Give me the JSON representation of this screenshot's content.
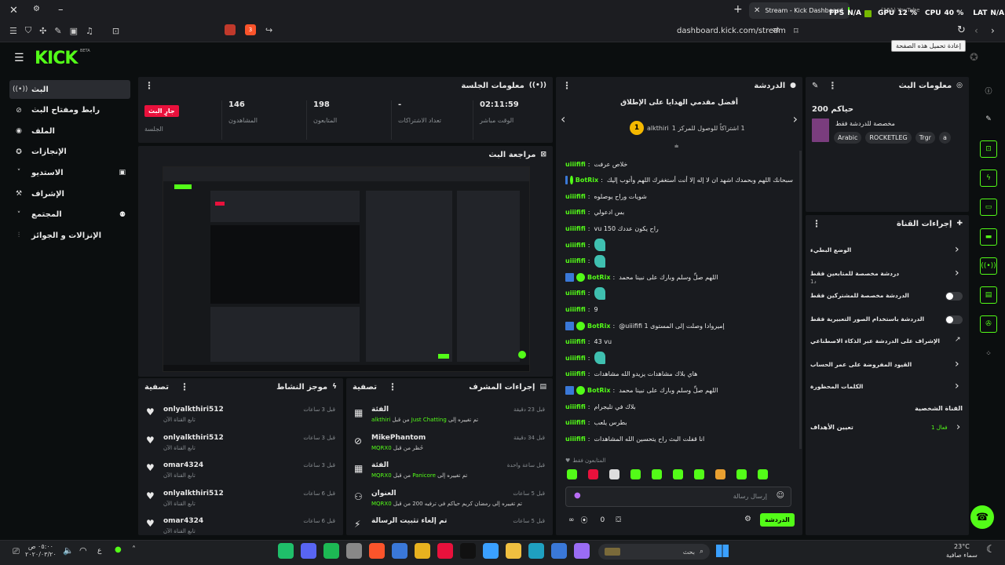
{
  "browser": {
    "tab_title": "Stream - Kick Dashboard",
    "url": "dashboard.kick.com/stream",
    "tooltip": "إعادة تحميل هذه الصفحة",
    "overlay": {
      "fps_label": "FPS",
      "fps": "N/A",
      "gpu_label": "GPU",
      "gpu": "12 %",
      "cpu_label": "CPU",
      "cpu": "40 %",
      "lat_label": "LAT",
      "lat": "N/A",
      "yt": "(161) YouTube"
    },
    "ext_badge": "3"
  },
  "app": {
    "logo": "KICK",
    "beta": "BETA"
  },
  "sidebar": {
    "items": [
      {
        "label": "البث",
        "icon": "broadcast-icon",
        "active": true
      },
      {
        "label": "رابط ومفتاح البث",
        "icon": "link-icon"
      },
      {
        "label": "الملف",
        "icon": "user-icon"
      },
      {
        "label": "الإنجازات",
        "icon": "trophy-icon"
      },
      {
        "label": "الاستديو",
        "icon": "studio-icon"
      },
      {
        "label": "الإشراف",
        "icon": "hammer-icon"
      },
      {
        "label": "المجتمع",
        "icon": "community-icon"
      },
      {
        "label": "الإنزالات و الجوائز",
        "icon": "rewards-icon"
      }
    ]
  },
  "session": {
    "title": "معلومات الجلسة",
    "live_badge": "جارٍ البث",
    "live_sub": "الجلسة",
    "stats": [
      {
        "value": "146",
        "label": "المشاهدون"
      },
      {
        "value": "198",
        "label": "المتابعون"
      },
      {
        "value": "-",
        "label": "تعداد الاشتراكات"
      },
      {
        "value": "02:11:59",
        "label": "الوقت مباشر"
      }
    ]
  },
  "preview": {
    "title": "مراجعة البث"
  },
  "activity": {
    "title": "موجز النشاط",
    "filter": "تصفية",
    "items": [
      {
        "name": "onlyalkthiri512",
        "sub": "تابع القناة الآن",
        "time": "قبل 3 ساعات"
      },
      {
        "name": "onlyalkthiri512",
        "sub": "تابع القناة الآن",
        "time": "قبل 3 ساعات"
      },
      {
        "name": "omar4324",
        "sub": "تابع القناة الآن",
        "time": "قبل 3 ساعات"
      },
      {
        "name": "onlyalkthiri512",
        "sub": "تابع القناة الآن",
        "time": "قبل 6 ساعات"
      },
      {
        "name": "omar4324",
        "sub": "تابع القناة الآن",
        "time": "قبل 6 ساعات"
      }
    ]
  },
  "mod": {
    "title": "إجراءات المشرف",
    "filter": "تصفية",
    "items": [
      {
        "title": "الفئة",
        "detail_pre": "تم تغييره إلى ",
        "detail_green": "Just Chatting",
        "detail_post": " من قبل ",
        "user": "alkthiri",
        "time": "قبل 23 دقيقة",
        "icon": "category-icon"
      },
      {
        "title": "MikePhantom",
        "detail_pre": "حُظر من قبل ",
        "detail_green": "",
        "detail_post": "",
        "user": "MQRX0",
        "time": "قبل 34 دقيقة",
        "icon": "ban-icon"
      },
      {
        "title": "الفئة",
        "detail_pre": "تم تغييره إلى ",
        "detail_green": "Panicore",
        "detail_post": " من قبل ",
        "user": "MQRX0",
        "time": "قبل ساعة واحدة",
        "icon": "category-icon"
      },
      {
        "title": "العنوان",
        "detail_pre": "تم تغييره إلى ",
        "detail_green": "",
        "detail_post": "رمضان كريم حياكم في ترفيه 200 من قبل ",
        "user": "MQRX0",
        "time": "قبل 5 ساعات",
        "icon": "title-icon"
      },
      {
        "title": "تم إلغاء تثبيت الرسالة",
        "detail_pre": "",
        "detail_green": "",
        "detail_post": "",
        "user": "",
        "time": "قبل 5 ساعات",
        "icon": "unpin-icon"
      }
    ]
  },
  "chat": {
    "title": "الدردشة",
    "promo_title": "أفضل مقدمي الهدايا على الإطلاق",
    "promo_sub": "1 اشتراكاً للوصول للمركز 1",
    "promo_rank": "1",
    "promo_user": "alkthiri",
    "messages": [
      {
        "user": "uiiififi",
        "text": "خلاص عرفت"
      },
      {
        "user": "BotRix",
        "bot": true,
        "text": "سبحانك اللهم وبحمدك اشهد ان لا إله إلا أنت أستغفرك اللهم وأتوب إليك"
      },
      {
        "user": "uiiififi",
        "text": "شويات وراح يوصلوه"
      },
      {
        "user": "uiiififi",
        "text": "بس ادعولي"
      },
      {
        "user": "uiiififi",
        "text": "vu راح يكون عددك 150"
      },
      {
        "user": "uiiififi",
        "text": "",
        "emote": true
      },
      {
        "user": "uiiififi",
        "text": "",
        "emote": true
      },
      {
        "user": "BotRix",
        "bot": true,
        "text": "اللهم صلِّ وسلم وبارك على نبينا محمد"
      },
      {
        "user": "uiiififi",
        "text": "",
        "emote": true
      },
      {
        "user": "uiiififi",
        "text": "9"
      },
      {
        "user": "BotRix",
        "bot": true,
        "text": "@uiiififi إميروادا وصلت إلى المستوى 1"
      },
      {
        "user": "uiiififi",
        "text": "43 vu"
      },
      {
        "user": "uiiififi",
        "text": "",
        "emote": true
      },
      {
        "user": "uiiififi",
        "text": "هاي بلاك مشاهدات يزيدو الله مشاهدات"
      },
      {
        "user": "BotRix",
        "bot": true,
        "text": "اللهم صلِّ وسلم وبارك على نبينا محمد"
      },
      {
        "user": "uiiififi",
        "text": "بلاك في تليجرام"
      },
      {
        "user": "uiiififi",
        "text": "بطرس يلعب"
      },
      {
        "user": "uiiififi",
        "text": "انا قفلت البث راح يتحسين الله المشاهدات"
      }
    ],
    "followers_only": "المتابعون فقط",
    "input_placeholder": "إرسال رسالة",
    "send": "الدردشة",
    "viewers_count": "0"
  },
  "stream_info": {
    "title": "معلومات البث",
    "stream_title": "حياكم 200",
    "category": "مخصصة للدردشة فقط",
    "tags": [
      "Arabic",
      "ROCKETLEG",
      "Trgr",
      "a"
    ]
  },
  "channel_actions": {
    "title": "إجراءات القناة",
    "items": [
      {
        "label": "الوضع البطيء",
        "type": "chevron"
      },
      {
        "label": "دردشة مخصصة للمتابعين فقط",
        "sub": "1د",
        "type": "chevron"
      },
      {
        "label": "الدردشة مخصصة للمشتركين فقط",
        "type": "toggle"
      },
      {
        "label": "الدردشة باستخدام الصور التعبيرية فقط",
        "type": "toggle"
      },
      {
        "label": "الإشراف على الدردشة عبر الذكاء الاصطناعي",
        "type": "external"
      },
      {
        "label": "القيود المفروضة على عمر الحساب",
        "type": "chevron"
      },
      {
        "label": "الكلمات المحظورة",
        "type": "chevron"
      }
    ],
    "personal_heading": "القناة الشخصية",
    "goals_label": "تعيين الأهداف",
    "goals_badge": "فعال 1"
  },
  "taskbar": {
    "time": "٠٥:٠٠ ص",
    "date": "٢٠٢٠/٠٣/٢٠",
    "search": "بحث",
    "weather_temp": "23°C",
    "weather_text": "سماء صافية",
    "lang": "ع"
  },
  "colors": {
    "accent": "#53fc18",
    "live": "#e9113c",
    "panel": "#191b1f",
    "bg": "#0b0e0f"
  }
}
